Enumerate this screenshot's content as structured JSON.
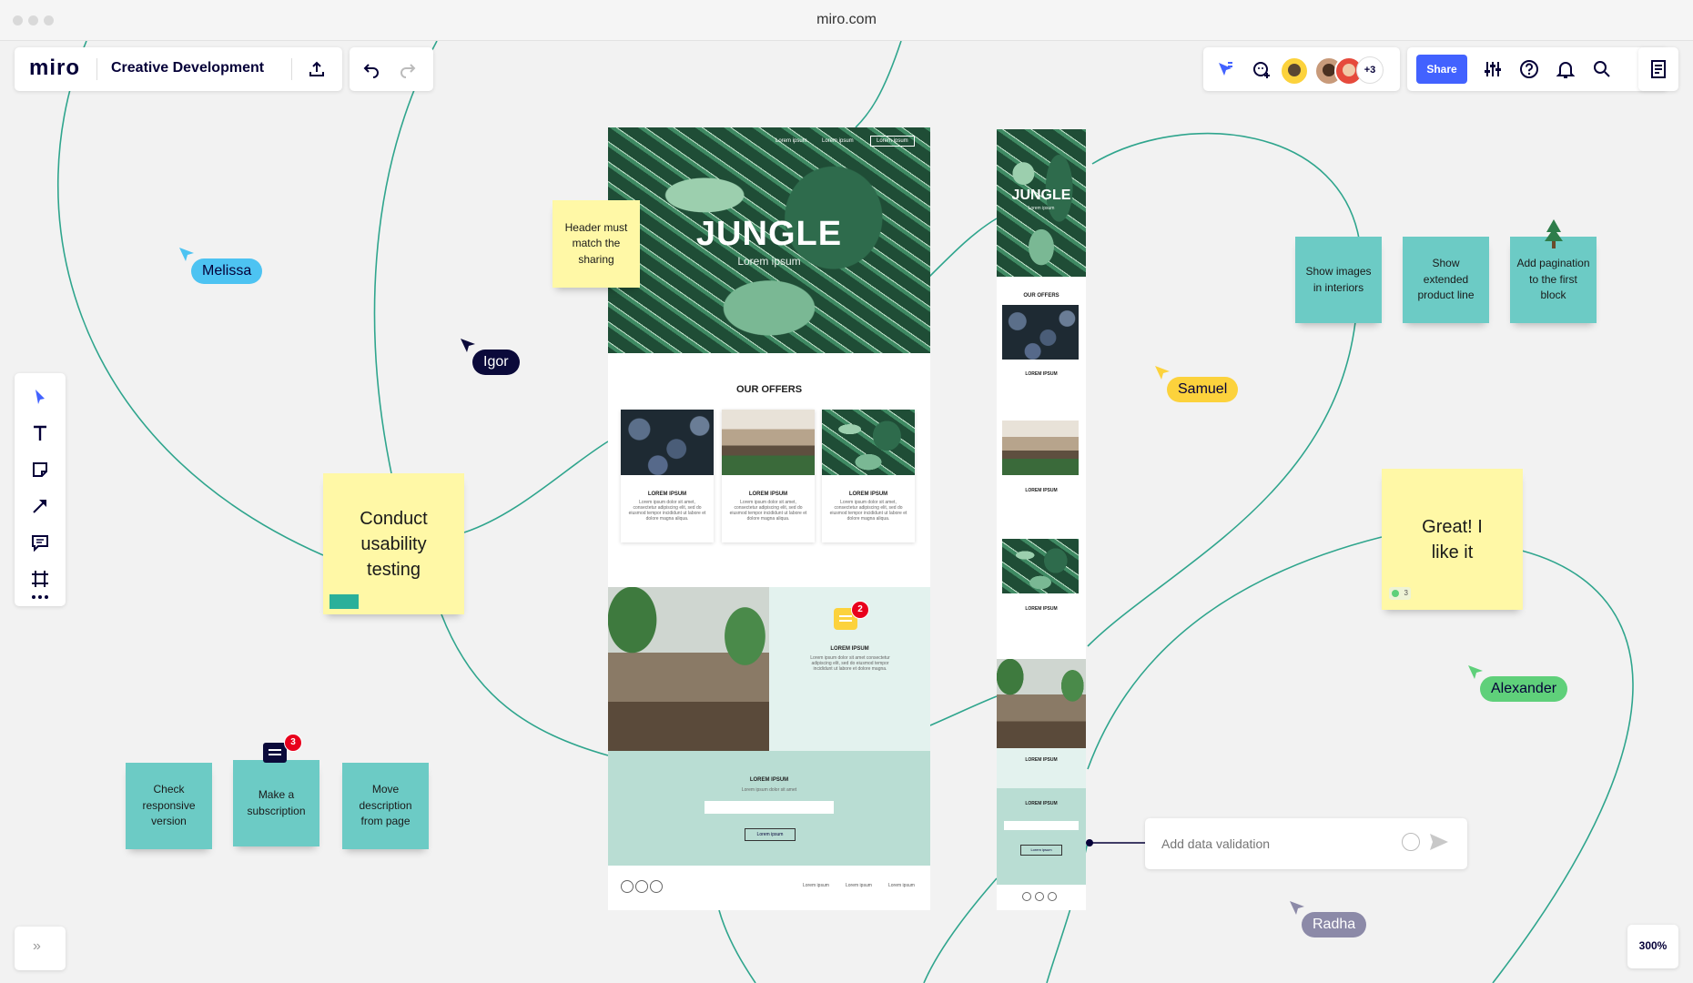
{
  "browser": {
    "url": "miro.com"
  },
  "board": {
    "logo": "miro",
    "title": "Creative Development",
    "zoom": "300%"
  },
  "topbar": {
    "share_label": "Share",
    "collaborators_more": "+3"
  },
  "mockup": {
    "nav_links": [
      "Lorem ipsum",
      "Lorem ipsum",
      "Lorem ipsum"
    ],
    "hero_title": "JUNGLE",
    "hero_subtitle": "Lorem ipsum",
    "offers_heading": "OUR OFFERS",
    "card_title": "LOREM IPSUM",
    "card_text": "Lorem ipsum dolor sit amet, consectetur adipiscing elit, sed do eiusmod tempor incididunt ut labore et dolore magna aliqua.",
    "feature_title": "LOREM IPSUM",
    "feature_text": "Lorem ipsum dolor sit amet consectetur adipiscing elit, sed do eiusmod tempor incididunt ut labore et dolore magna.",
    "comment_count": "2",
    "signup_title": "LOREM IPSUM",
    "signup_text": "Lorem ipsum dolor sit amet",
    "signup_button": "Lorem ipsum",
    "footer_links": [
      "Lorem ipsum",
      "Lorem ipsum",
      "Lorem ipsum"
    ]
  },
  "mobile": {
    "hero_title": "JUNGLE",
    "hero_subtitle": "Lorem ipsum",
    "offers_heading": "OUR OFFERS",
    "card_title": "LOREM IPSUM",
    "signup_title": "LOREM IPSUM",
    "signup_button": "Lorem ipsum"
  },
  "stickies": {
    "header_note": "Header must match the sharing",
    "usability": "Conduct usability testing",
    "great": "Great! I like it",
    "great_votes": "3",
    "show_images": "Show images in interiors",
    "show_extended": "Show extended product line",
    "add_pagination": "Add pagination to the first block",
    "check_responsive": "Check responsive version",
    "make_subscription": "Make a subscription",
    "move_description": "Move description from page",
    "subscription_comments": "3"
  },
  "cursors": [
    {
      "name": "Melissa",
      "color": "#4dc3f2"
    },
    {
      "name": "Igor",
      "color": "#0b0a3a"
    },
    {
      "name": "Samuel",
      "color": "#fcd23c"
    },
    {
      "name": "Alexander",
      "color": "#5fd07a"
    },
    {
      "name": "Radha",
      "color": "#8c8aa8"
    }
  ],
  "comment_input": {
    "placeholder": "Add data validation"
  }
}
